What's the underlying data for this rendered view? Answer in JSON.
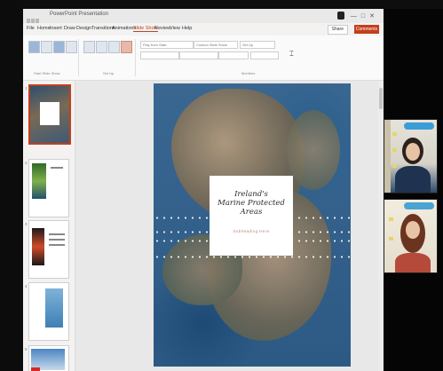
{
  "window": {
    "title": "PowerPoint Presentation"
  },
  "menu": {
    "tabs": [
      "File",
      "Home",
      "Insert",
      "Draw",
      "Design",
      "Transitions",
      "Animations",
      "Slide Show",
      "Review",
      "View",
      "Help"
    ],
    "active_tab": "Slide Show",
    "share_label": "Share",
    "comments_label": "Comments"
  },
  "ribbon": {
    "field1": "Play from Start",
    "field2": "Custom Slide Show",
    "field3": "Set Up",
    "group_labels": [
      "Start Slide Show",
      "Set Up",
      "Monitors"
    ]
  },
  "slide": {
    "title_lines": [
      "Ireland's",
      "Marine Protected Areas"
    ],
    "subtitle": "Subheading Here"
  },
  "thumbnails": {
    "numbers": [
      "1",
      "2",
      "3",
      "4",
      "5"
    ],
    "selected_index": 1
  },
  "colors": {
    "accent": "#c43e1c",
    "badge": "#3a9dd6"
  }
}
